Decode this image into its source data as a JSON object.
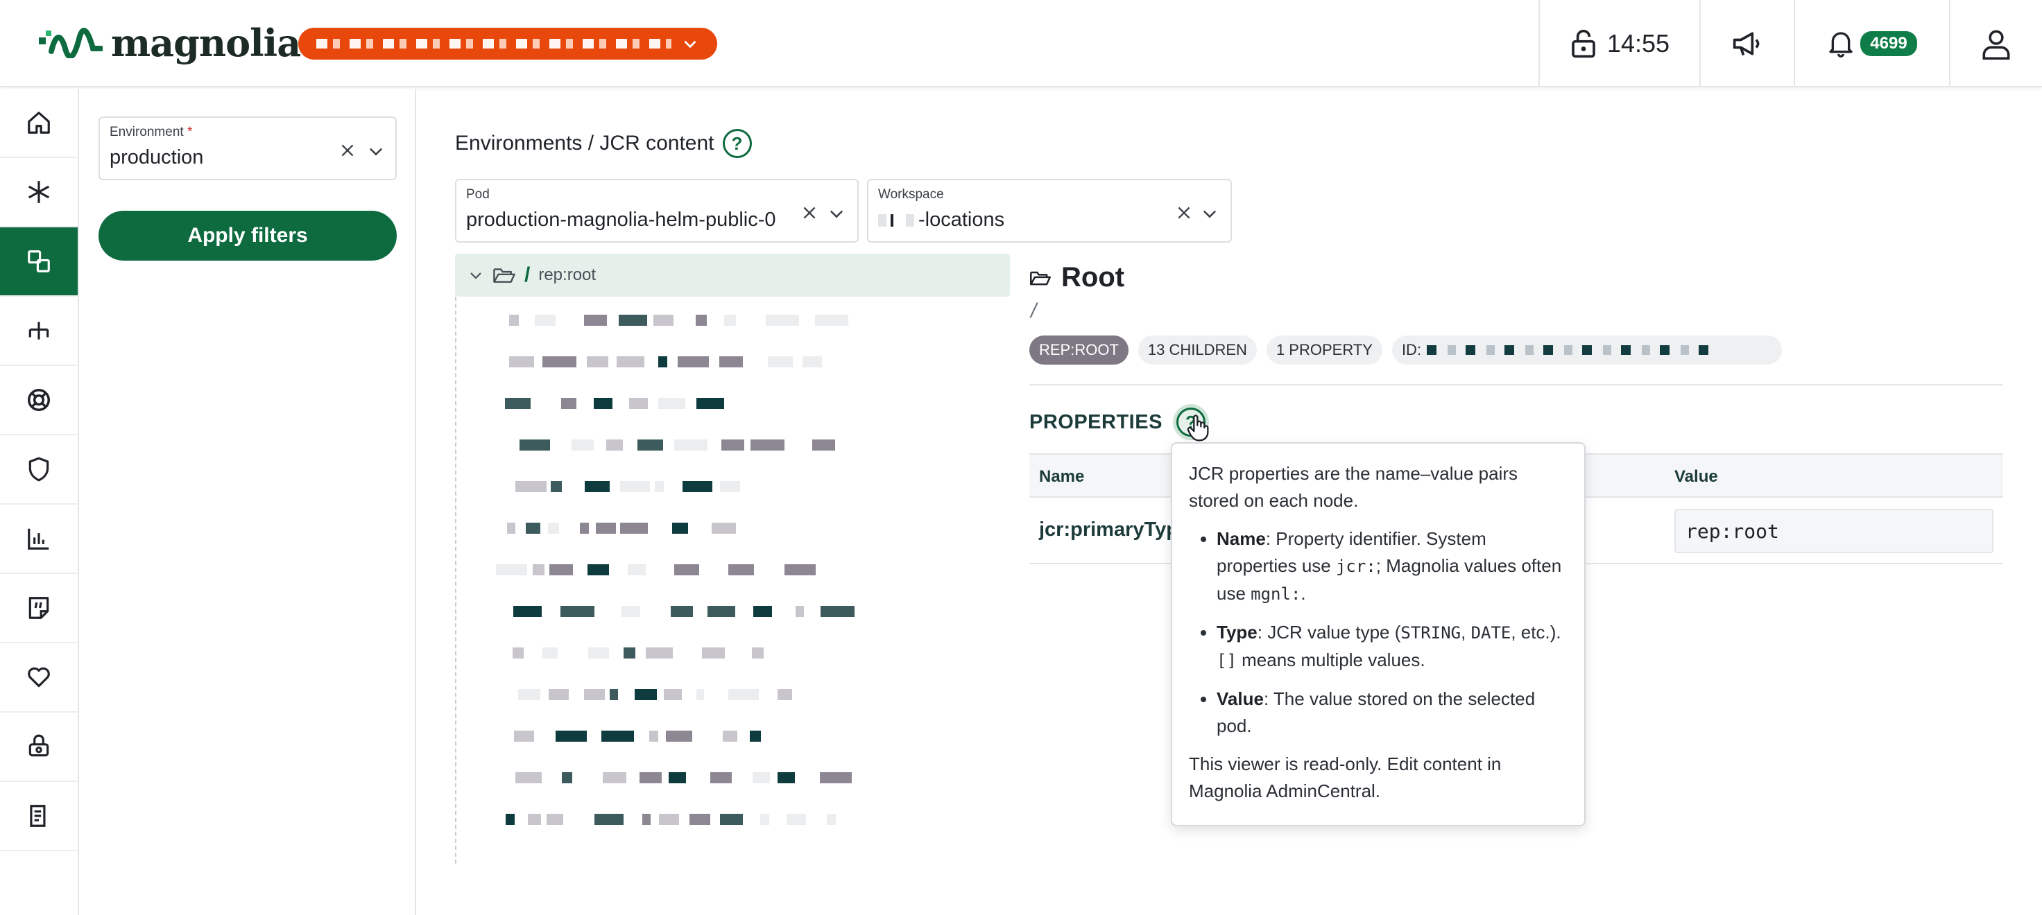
{
  "brand": {
    "name": "magnolia",
    "green": "#0d6b3f",
    "accent_orange": "#e8480c"
  },
  "header": {
    "environment_pill": "redacted",
    "session_time": "14:55",
    "notifications_count": "4699"
  },
  "nav": {
    "items": [
      {
        "icon": "home-icon"
      },
      {
        "icon": "asterisk-icon"
      },
      {
        "icon": "environments-icon",
        "active": true
      },
      {
        "icon": "fork-icon"
      },
      {
        "icon": "support-icon"
      },
      {
        "icon": "shield-icon"
      },
      {
        "icon": "analytics-icon"
      },
      {
        "icon": "note-icon"
      },
      {
        "icon": "heart-icon"
      },
      {
        "icon": "lab-icon"
      },
      {
        "icon": "document-icon"
      }
    ]
  },
  "filters": {
    "environment_label": "Environment",
    "environment_required": "*",
    "environment_value": "production",
    "apply_label": "Apply filters"
  },
  "main": {
    "breadcrumb": "Environments / JCR content",
    "help": "?",
    "pod_label": "Pod",
    "pod_value": "production-magnolia-helm-public-0",
    "workspace_label": "Workspace",
    "workspace_value": "-locations"
  },
  "tree": {
    "root_slash": "/",
    "root_name": "rep:root"
  },
  "detail": {
    "title": "Root",
    "path": "/",
    "chips": {
      "type": "REP:ROOT",
      "children": "13 CHILDREN",
      "properties": "1 PROPERTY",
      "id_prefix": "ID:"
    },
    "properties_title": "PROPERTIES",
    "table": {
      "col_name": "Name",
      "col_value": "Value",
      "rows": [
        {
          "name": "jcr:primaryType",
          "value": "rep:root"
        }
      ]
    }
  },
  "tooltip": {
    "intro": "JCR properties are the name–value pairs stored on each node.",
    "name_term": "Name",
    "name_text_1": ": Property identifier. System properties use ",
    "name_code_1": "jcr:",
    "name_text_2": "; Magnolia values often use ",
    "name_code_2": "mgnl:",
    "name_text_3": ".",
    "type_term": "Type",
    "type_text_1": ": JCR value type (",
    "type_code_1": "STRING",
    "type_text_2": ", ",
    "type_code_2": "DATE",
    "type_text_3": ", etc.). ",
    "type_code_3": "[]",
    "type_text_4": " means multiple values.",
    "value_term": "Value",
    "value_text": ": The value stored on the selected pod.",
    "footer": "This viewer is read-only. Edit content in Magnolia AdminCentral."
  }
}
